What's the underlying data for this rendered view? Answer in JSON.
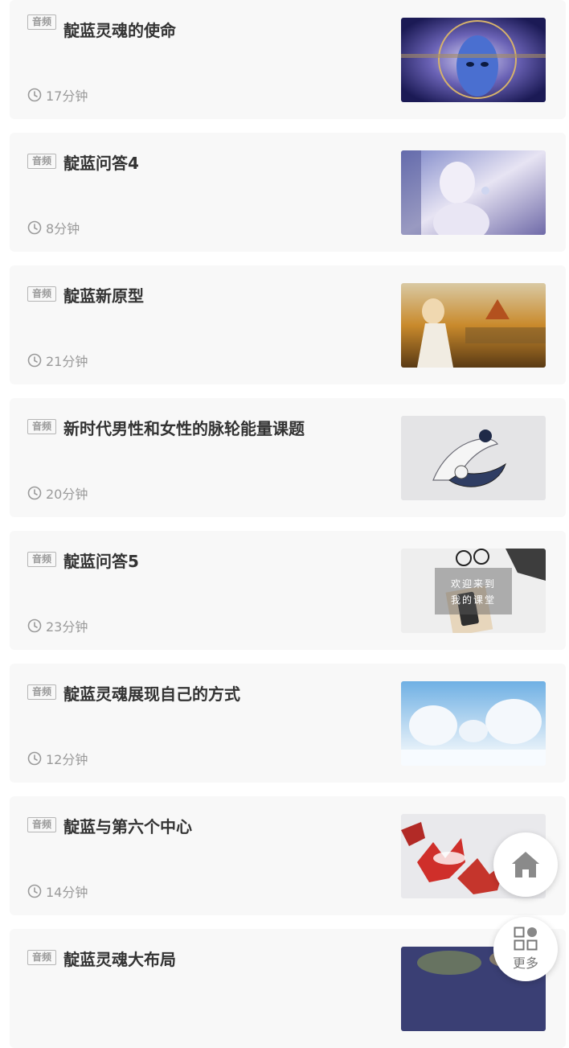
{
  "items": [
    {
      "tag": "音频",
      "title": "靛蓝灵魂的使命",
      "duration": "17分钟",
      "thumb": "blue-face-illustration"
    },
    {
      "tag": "音频",
      "title": "靛蓝问答4",
      "duration": "8分钟",
      "thumb": "ethereal-woman-illustration"
    },
    {
      "tag": "音频",
      "title": "靛蓝新原型",
      "duration": "21分钟",
      "thumb": "autumn-girl-illustration"
    },
    {
      "tag": "音频",
      "title": "新时代男性和女性的脉轮能量课题",
      "duration": "20分钟",
      "thumb": "koi-yin-yang-illustration"
    },
    {
      "tag": "音频",
      "title": "靛蓝问答5",
      "duration": "23分钟",
      "thumb": "classroom-desk-photo",
      "thumb_text": [
        "欢迎来到",
        "我的课堂"
      ]
    },
    {
      "tag": "音频",
      "title": "靛蓝灵魂展现自己的方式",
      "duration": "12分钟",
      "thumb": "snowy-trees-photo"
    },
    {
      "tag": "音频",
      "title": "靛蓝与第六个中心",
      "duration": "14分钟",
      "thumb": "red-leaves-snow-photo"
    },
    {
      "tag": "音频",
      "title": "靛蓝灵魂大布局",
      "duration": "",
      "thumb": "dark-night-illustration"
    }
  ],
  "fab": {
    "home_icon": "home-icon",
    "more_icon": "grid-icon",
    "more_label": "更多"
  },
  "colors": {
    "card_bg": "#f8f8f8",
    "title": "#333333",
    "meta": "#9a9a9a"
  }
}
